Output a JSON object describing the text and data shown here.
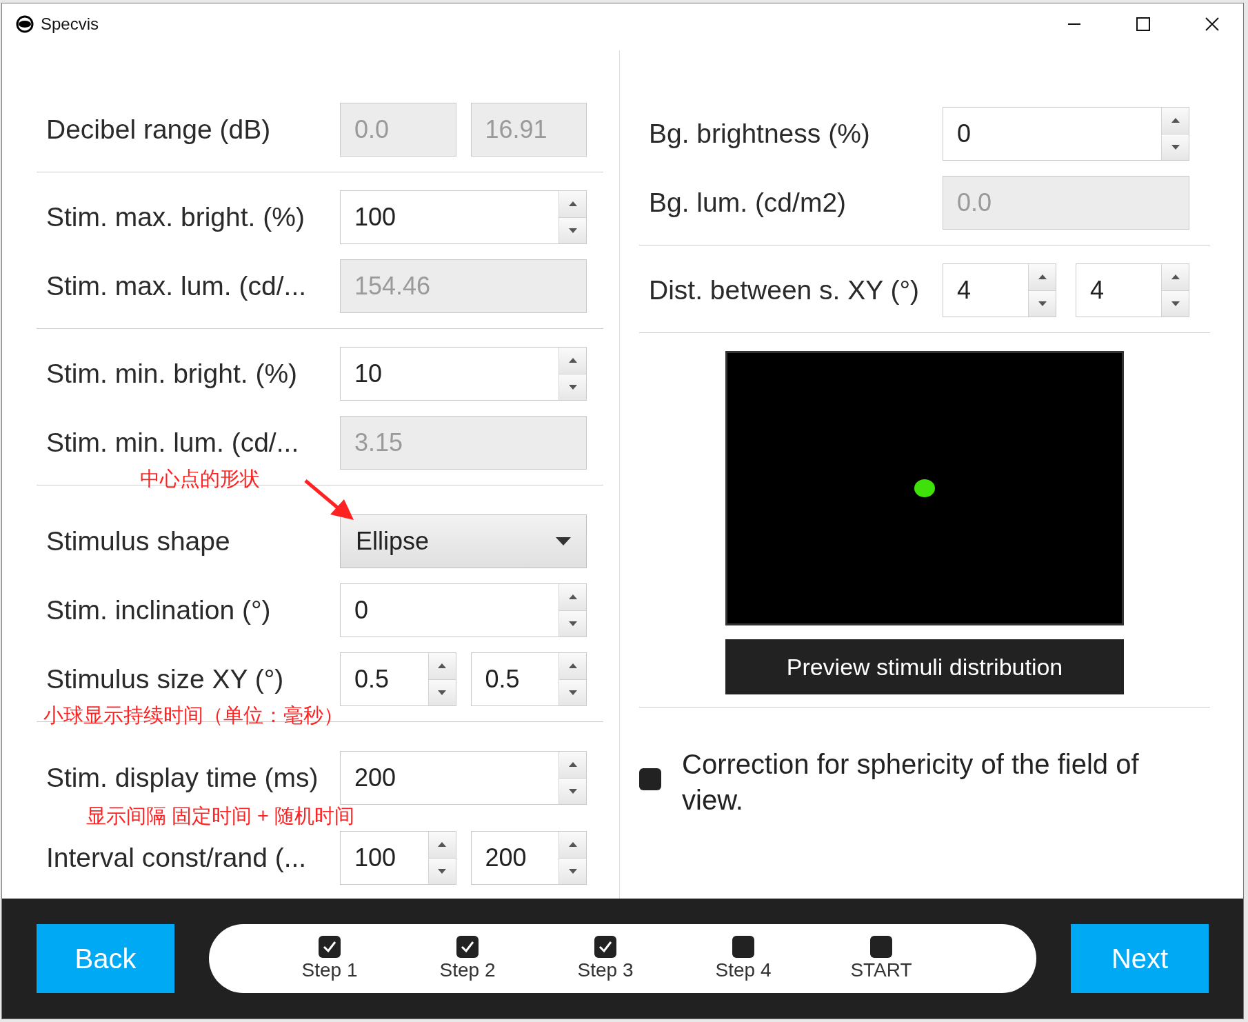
{
  "window": {
    "title": "Specvis"
  },
  "left_groups": [
    [
      {
        "label": "Decibel range (dB)",
        "fields": [
          {
            "kind": "text",
            "value": "0.0",
            "disabled": true
          },
          {
            "kind": "text",
            "value": "16.91",
            "disabled": true
          }
        ]
      }
    ],
    [
      {
        "label": "Stim. max. bright. (%)",
        "fields": [
          {
            "kind": "spin",
            "value": "100",
            "disabled": false
          }
        ]
      },
      {
        "label": "Stim. max. lum. (cd/...",
        "fields": [
          {
            "kind": "text",
            "value": "154.46",
            "disabled": true
          }
        ]
      }
    ],
    [
      {
        "label": "Stim. min. bright. (%)",
        "fields": [
          {
            "kind": "spin",
            "value": "10",
            "disabled": false
          }
        ]
      },
      {
        "label": "Stim. min. lum. (cd/...",
        "fields": [
          {
            "kind": "text",
            "value": "3.15",
            "disabled": true
          }
        ]
      }
    ],
    [
      {
        "label": "Stimulus shape",
        "annotation": {
          "text": "中心点的形状",
          "arrow": true
        },
        "fields": [
          {
            "kind": "dropdown",
            "value": "Ellipse",
            "disabled": false
          }
        ]
      },
      {
        "label": "Stim. inclination (°)",
        "fields": [
          {
            "kind": "spin",
            "value": "0",
            "disabled": false
          }
        ]
      },
      {
        "label": "Stimulus size XY (°)",
        "fields": [
          {
            "kind": "spin",
            "value": "0.5",
            "disabled": false
          },
          {
            "kind": "spin",
            "value": "0.5",
            "disabled": false
          }
        ]
      }
    ],
    [
      {
        "label": "Stim. display time (ms)",
        "annotation": {
          "text": "小球显示持续时间（单位：毫秒）"
        },
        "fields": [
          {
            "kind": "spin",
            "value": "200",
            "disabled": false
          }
        ]
      },
      {
        "label": "Interval const/rand (...",
        "annotation": {
          "text": "显示间隔 固定时间 + 随机时间"
        },
        "fields": [
          {
            "kind": "spin",
            "value": "100",
            "disabled": false
          },
          {
            "kind": "spin",
            "value": "200",
            "disabled": false
          }
        ]
      }
    ]
  ],
  "right_groups": [
    [
      {
        "label": "Bg. brightness (%)",
        "fields": [
          {
            "kind": "spin",
            "value": "0",
            "disabled": false
          }
        ]
      },
      {
        "label": "Bg. lum. (cd/m2)",
        "fields": [
          {
            "kind": "text",
            "value": "0.0",
            "disabled": true
          }
        ]
      }
    ],
    [
      {
        "label": "Dist. between s. XY (°)",
        "fields": [
          {
            "kind": "spin",
            "value": "4",
            "disabled": false
          },
          {
            "kind": "spin",
            "value": "4",
            "disabled": false
          }
        ]
      }
    ]
  ],
  "preview": {
    "button": "Preview stimuli distribution"
  },
  "option": {
    "label": "Correction for sphericity of the field of view.",
    "checked": false
  },
  "footer": {
    "back": "Back",
    "next": "Next",
    "steps": [
      {
        "label": "Step 1",
        "checked": true
      },
      {
        "label": "Step 2",
        "checked": true
      },
      {
        "label": "Step 3",
        "checked": true
      },
      {
        "label": "Step 4",
        "checked": false
      },
      {
        "label": "START",
        "checked": false
      }
    ]
  }
}
